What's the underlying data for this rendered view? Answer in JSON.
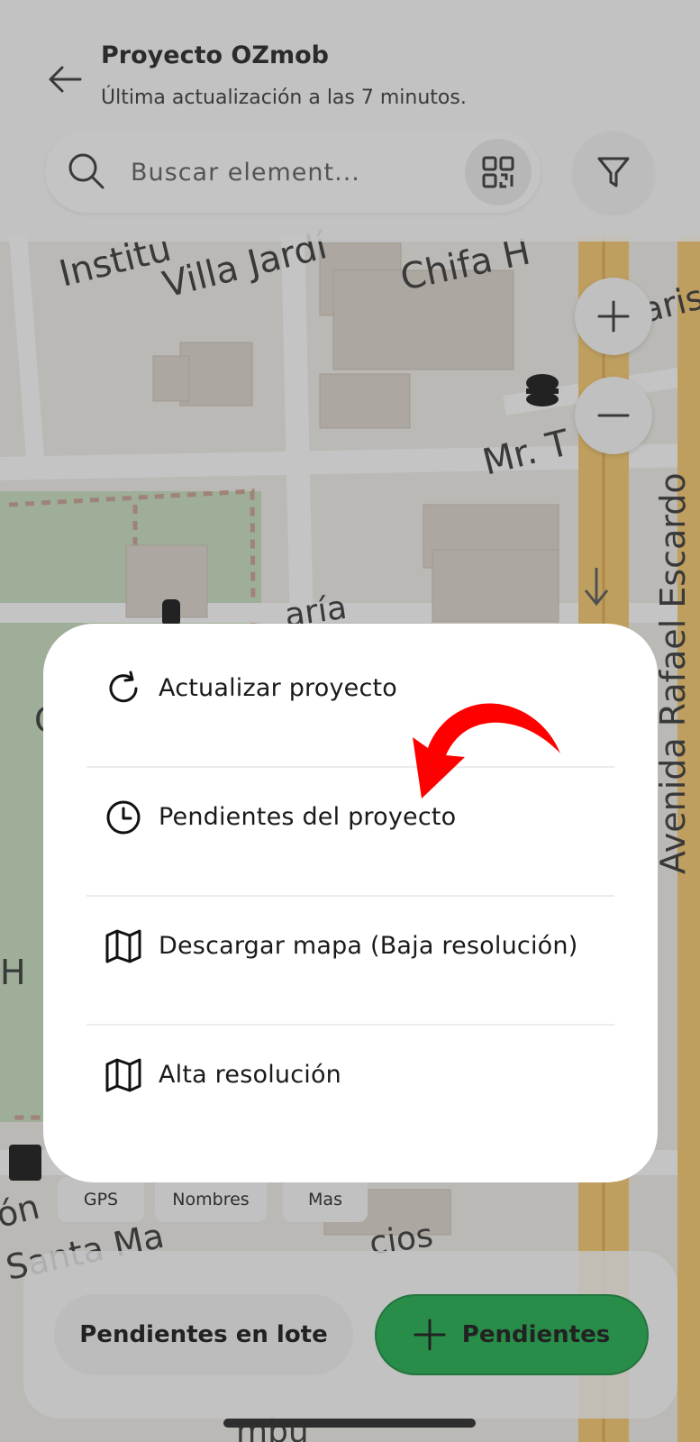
{
  "header": {
    "back_icon": "arrow-left-icon",
    "title": "Proyecto OZmob",
    "subtitle": "Última actualización a las 7 minutos."
  },
  "search": {
    "placeholder": "Buscar element...",
    "value": "",
    "qr_icon": "qr-code-icon",
    "filter_icon": "filter-icon"
  },
  "map": {
    "labels": {
      "institute": "Institu",
      "villa": "Villa Jardí",
      "chifa": "Chifa H",
      "paris": "aris",
      "mr": "Mr. T",
      "avenida": "Avenida Rafael Escardo",
      "maria": "aría",
      "santa": "Santa Ma",
      "ion": "ón",
      "cios": "cios",
      "h": "H",
      "c": "C",
      "mbu": "mbu"
    },
    "zoom_in": "+",
    "zoom_out": "−"
  },
  "chips": [
    "GPS",
    "Nombres",
    "Mas"
  ],
  "menu": {
    "items": [
      {
        "label": "Actualizar proyecto",
        "icon": "refresh-icon"
      },
      {
        "label": "Pendientes del proyecto",
        "icon": "clock-icon"
      },
      {
        "label": "Descargar mapa (Baja resolución)",
        "icon": "map-icon"
      },
      {
        "label": "Alta resolución",
        "icon": "map-icon"
      }
    ]
  },
  "bottom": {
    "batch_label": "Pendientes en lote",
    "add_label": "Pendientes",
    "add_icon": "plus-icon"
  },
  "colors": {
    "accent_green": "#1aae4b",
    "annotation_arrow": "#ff0000",
    "park_green": "#c8dfc0",
    "road_yellow": "#f7c96b"
  }
}
